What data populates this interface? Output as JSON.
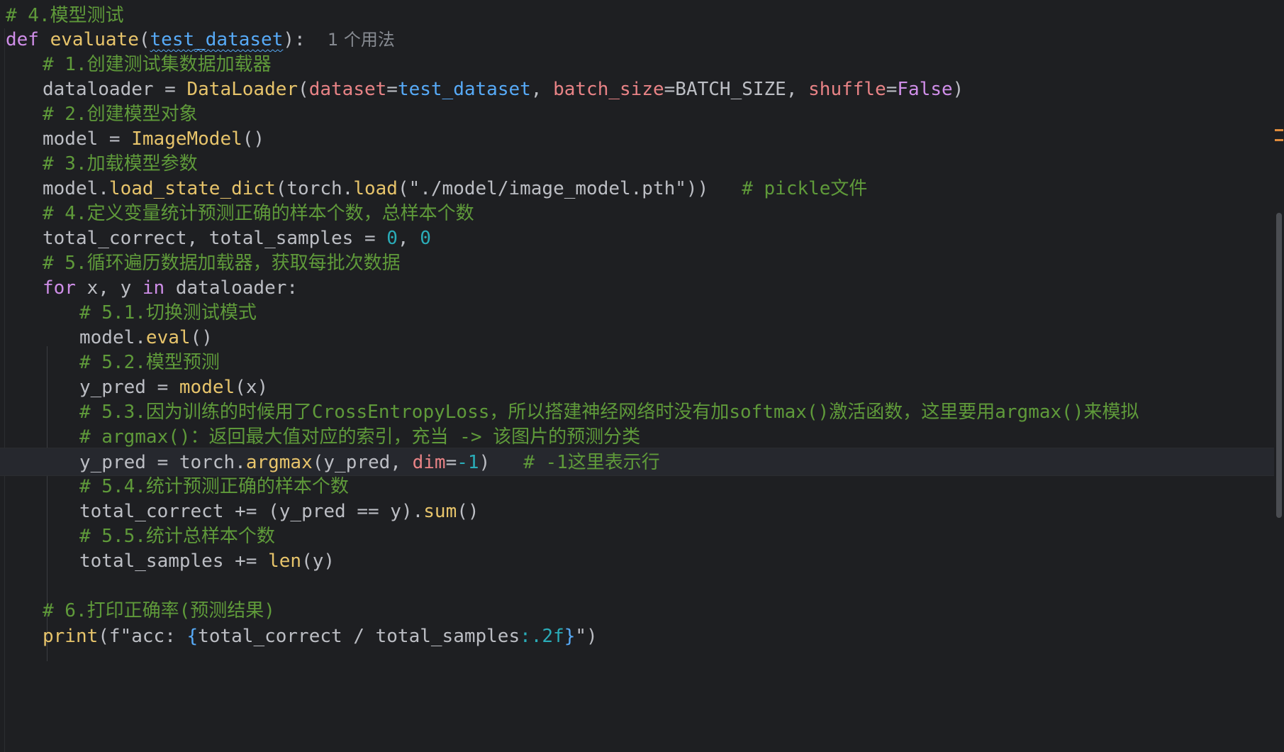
{
  "editor": {
    "usage_hint": "1 个用法",
    "lines": {
      "l1": "# 4.模型测试",
      "l2_def": "def",
      "l2_fn": "evaluate",
      "l2_param": "test_dataset",
      "l3": "# 1.创建测试集数据加载器",
      "l4_var": "dataloader = ",
      "l4_cls": "DataLoader",
      "l4_k1": "dataset",
      "l4_v1": "test_dataset",
      "l4_k2": "batch_size",
      "l4_v2": "BATCH_SIZE",
      "l4_k3": "shuffle",
      "l4_v3": "False",
      "l5": "# 2.创建模型对象",
      "l6_var": "model = ",
      "l6_cls": "ImageModel",
      "l7": "# 3.加载模型参数",
      "l8_a": "model.",
      "l8_fn": "load_state_dict",
      "l8_b": "(torch.",
      "l8_fn2": "load",
      "l8_str": "(\"./model/image_model.pth\"))",
      "l8_cm": "# pickle文件",
      "l9": "# 4.定义变量统计预测正确的样本个数，总样本个数",
      "l10_var": "total_correct, total_samples = ",
      "l10_n1": "0",
      "l10_n2": "0",
      "l11": "# 5.循环遍历数据加载器，获取每批次数据",
      "l12_for": "for",
      "l12_mid": " x, y ",
      "l12_in": "in",
      "l12_end": " dataloader:",
      "l13": "# 5.1.切换测试模式",
      "l14_a": "model.",
      "l14_fn": "eval",
      "l15": "# 5.2.模型预测",
      "l16_a": "y_pred = ",
      "l16_fn": "model",
      "l16_b": "(x)",
      "l17": "# 5.3.因为训练的时候用了CrossEntropyLoss，所以搭建神经网络时没有加softmax()激活函数，这里要用argmax()来模拟",
      "l18": "# argmax()：返回最大值对应的索引，充当 -> 该图片的预测分类",
      "l19_a": "y_pred = torch.",
      "l19_fn": "argmax",
      "l19_b": "(y_pred, ",
      "l19_k": "dim",
      "l19_n": "-1",
      "l19_cm": "# -1这里表示行",
      "l20": "# 5.4.统计预测正确的样本个数",
      "l21_a": "total_correct += (y_pred == y).",
      "l21_fn": "sum",
      "l22": "# 5.5.统计总样本个数",
      "l23_a": "total_samples += ",
      "l23_fn": "len",
      "l23_b": "(y)",
      "l25": "# 6.打印正确率(预测结果)",
      "l26_fn": "print",
      "l26_a": "(f\"acc: ",
      "l26_b": "total_correct / total_samples",
      "l26_c": ":.2f",
      "l26_d": "\")"
    }
  }
}
